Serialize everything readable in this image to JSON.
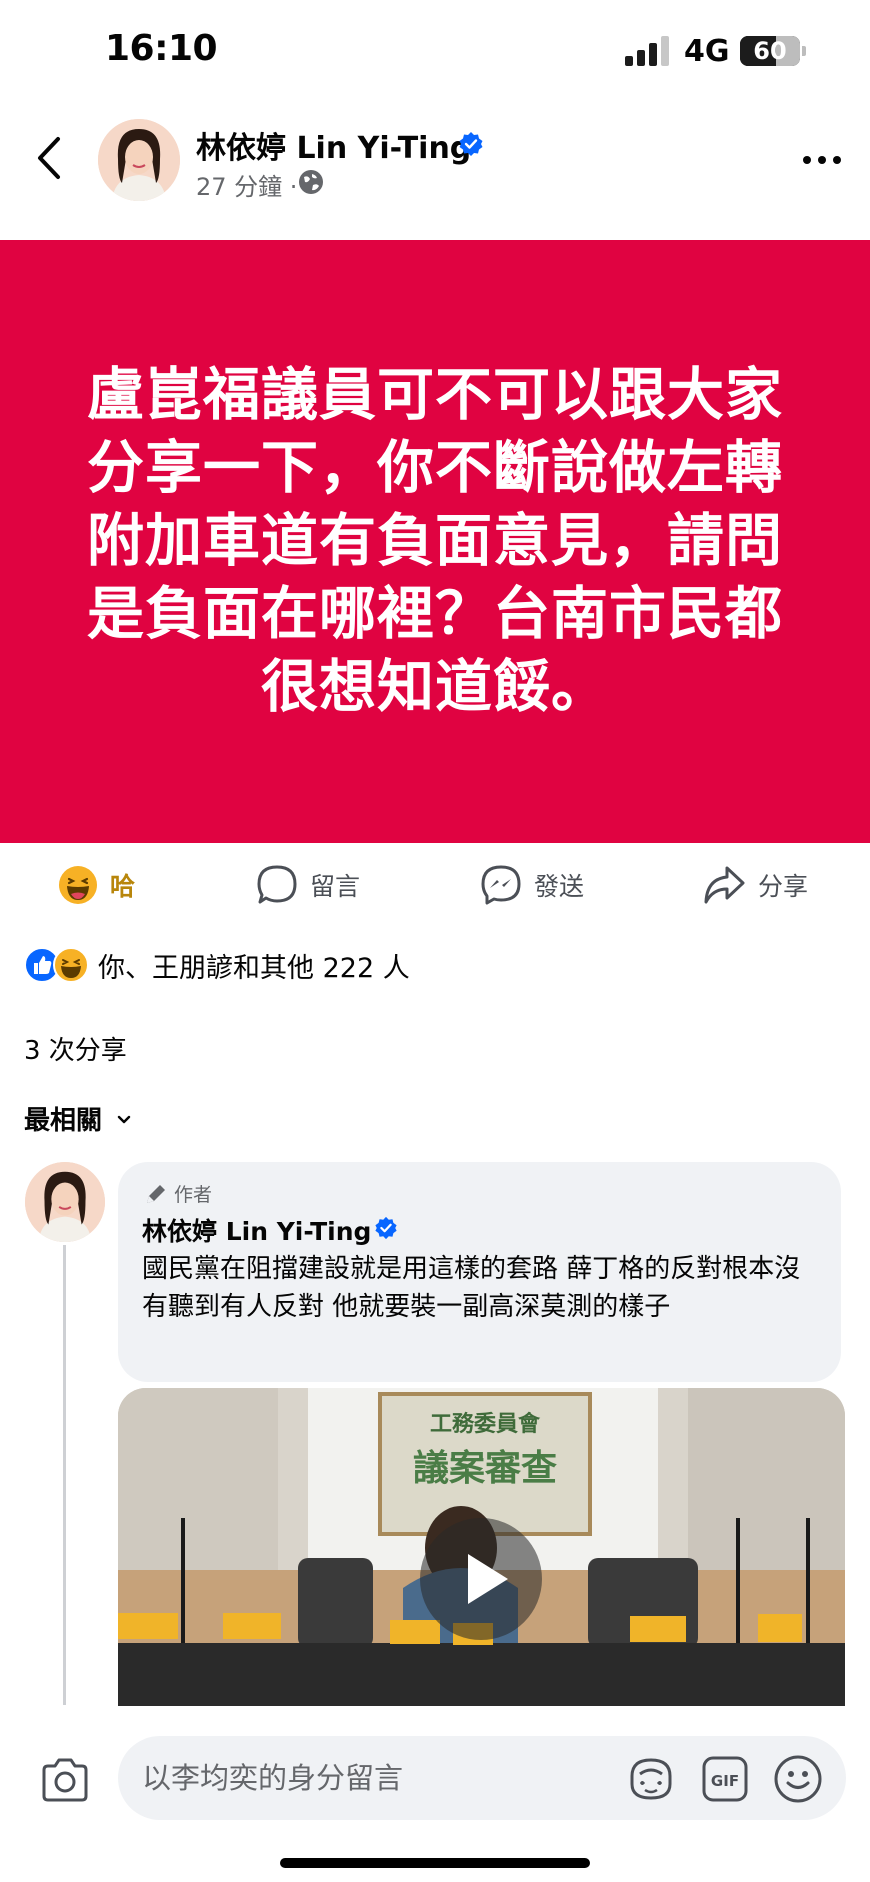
{
  "status_bar": {
    "time": "16:10",
    "network": "4G",
    "battery": "60",
    "battery_level": 0.6
  },
  "post": {
    "author": "林依婷 Lin Yi-Ting",
    "time": "27 分鐘 ·",
    "banner_text": "盧崑福議員可不可以跟大家\n分享一下，你不斷說做左轉\n附加車道有負面意見，請問\n是負面在哪裡？台南市民都\n很想知道餒。",
    "banner_color": "#e00341"
  },
  "actions": [
    {
      "label": "哈",
      "icon": "haha-emoji-icon"
    },
    {
      "label": "留言",
      "icon": "comment-bubble-icon"
    },
    {
      "label": "發送",
      "icon": "messenger-icon"
    },
    {
      "label": "分享",
      "icon": "share-arrow-icon"
    }
  ],
  "reactions_text": "你、王朋諺和其他 222 人",
  "shares_text": "3 次分享",
  "sort_label": "最相關",
  "comment": {
    "badge": "作者",
    "author": "林依婷 Lin Yi-Ting",
    "text": "國民黨在阻擋建設就是用這樣的套路 薛丁格的反對根本沒有聽到有人反對 他就要裝一副高深莫測的樣子"
  },
  "video": {
    "sign_line1": "工務委員會",
    "sign_line2": "議案審查"
  },
  "composer": {
    "placeholder": "以李均奕的身分留言",
    "gif_label": "GIF"
  },
  "colors": {
    "accent": "#0866ff",
    "haha": "#f7b125"
  }
}
